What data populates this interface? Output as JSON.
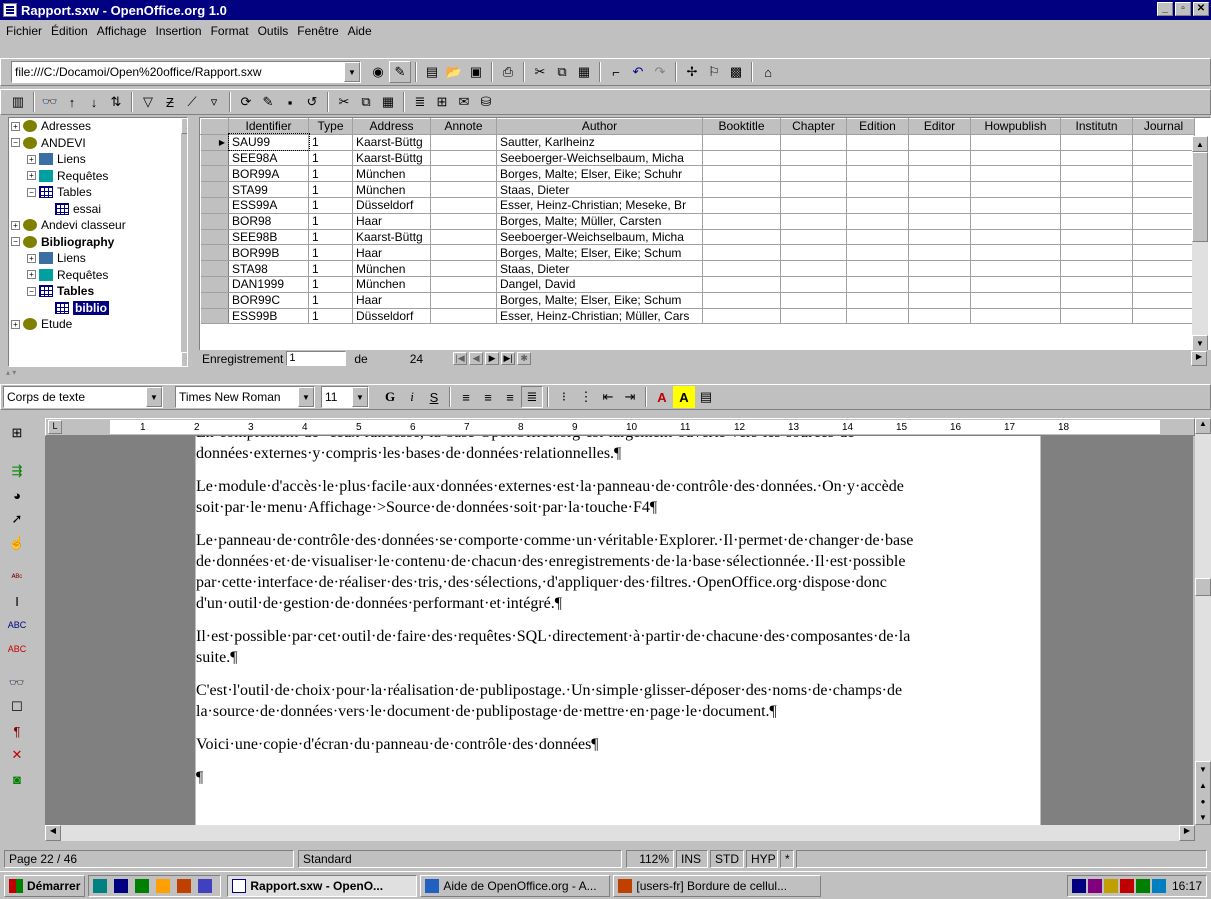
{
  "window": {
    "title": "Rapport.sxw - OpenOffice.org 1.0"
  },
  "menu": [
    "Fichier",
    "Édition",
    "Affichage",
    "Insertion",
    "Format",
    "Outils",
    "Fenêtre",
    "Aide"
  ],
  "url_bar": {
    "value": "file:///C:/Docamoi/Open%20office/Rapport.sxw"
  },
  "tree": [
    {
      "label": "Adresses",
      "level": 0,
      "expander": "+",
      "icon": "database-icon",
      "bold": false
    },
    {
      "label": "ANDEVI",
      "level": 0,
      "expander": "-",
      "icon": "database-icon",
      "bold": false
    },
    {
      "label": "Liens",
      "level": 1,
      "expander": "+",
      "icon": "links-icon",
      "bold": false
    },
    {
      "label": "Requêtes",
      "level": 1,
      "expander": "+",
      "icon": "queries-icon",
      "bold": false
    },
    {
      "label": "Tables",
      "level": 1,
      "expander": "-",
      "icon": "tables-icon",
      "bold": false
    },
    {
      "label": "essai",
      "level": 2,
      "expander": "",
      "icon": "table-icon",
      "bold": false
    },
    {
      "label": "Andevi classeur",
      "level": 0,
      "expander": "+",
      "icon": "database-icon",
      "bold": false
    },
    {
      "label": "Bibliography",
      "level": 0,
      "expander": "-",
      "icon": "database-icon",
      "bold": true
    },
    {
      "label": "Liens",
      "level": 1,
      "expander": "+",
      "icon": "links-icon",
      "bold": false
    },
    {
      "label": "Requêtes",
      "level": 1,
      "expander": "+",
      "icon": "queries-icon",
      "bold": false
    },
    {
      "label": "Tables",
      "level": 1,
      "expander": "-",
      "icon": "tables-icon",
      "bold": true
    },
    {
      "label": "biblio",
      "level": 2,
      "expander": "",
      "icon": "table-icon",
      "bold": true,
      "selected": true
    },
    {
      "label": "Etude",
      "level": 0,
      "expander": "+",
      "icon": "database-icon",
      "bold": false
    }
  ],
  "grid": {
    "columns": [
      "Identifier",
      "Type",
      "Address",
      "Annote",
      "Author",
      "Booktitle",
      "Chapter",
      "Edition",
      "Editor",
      "Howpublish",
      "Institutn",
      "Journal"
    ],
    "rows": [
      [
        "SAU99",
        "1",
        "Kaarst-Büttg",
        "",
        "Sautter, Karlheinz"
      ],
      [
        "SEE98A",
        "1",
        "Kaarst-Büttg",
        "",
        "Seeboerger-Weichselbaum, Micha"
      ],
      [
        "BOR99A",
        "1",
        "München",
        "",
        "Borges, Malte; Elser, Eike; Schuhr"
      ],
      [
        "STA99",
        "1",
        "München",
        "",
        "Staas, Dieter"
      ],
      [
        "ESS99A",
        "1",
        "Düsseldorf",
        "",
        "Esser, Heinz-Christian; Meseke, Br"
      ],
      [
        "BOR98",
        "1",
        "Haar",
        "",
        "Borges, Malte; Müller, Carsten"
      ],
      [
        "SEE98B",
        "1",
        "Kaarst-Büttg",
        "",
        "Seeboerger-Weichselbaum, Micha"
      ],
      [
        "BOR99B",
        "1",
        "Haar",
        "",
        "Borges, Malte; Elser, Eike; Schum"
      ],
      [
        "STA98",
        "1",
        "München",
        "",
        "Staas, Dieter"
      ],
      [
        "DAN1999",
        "1",
        "München",
        "",
        "Dangel, David"
      ],
      [
        "BOR99C",
        "1",
        "Haar",
        "",
        "Borges, Malte; Elser, Eike; Schum"
      ],
      [
        "ESS99B",
        "1",
        "Düsseldorf",
        "",
        "Esser, Heinz-Christian; Müller, Cars"
      ]
    ]
  },
  "record_nav": {
    "label": "Enregistrement",
    "current": "1",
    "of": "de",
    "total": "24"
  },
  "format": {
    "style": "Corps de texte",
    "font": "Times New Roman",
    "size": "11"
  },
  "doc": {
    "paragraphs": [
      "En·complément·de··ceux·ralicesse,·la·base·OpenOffice.org·est·largement·ouverte·vers·les·sources·de",
      "données·externes·y·compris·les·bases·de·données·relationnelles.¶",
      "Le·module·d'accès·le·plus·facile·aux·données·externes·est·la·panneau·de·contrôle·des·données.·On·y·accède",
      "soit·par·le·menu·Affichage·>Source·de·données·soit·par·la·touche·F4¶",
      "Le·panneau·de·contrôle·des·données·se·comporte·comme·un·véritable·Explorer.·Il·permet·de·changer·de·base",
      "de·données·et·de·visualiser·le·contenu·de·chacun·des·enregistrements·de·la·base·sélectionnée.·Il·est·possible",
      "par·cette·interface·de·réaliser·des·tris,·des·sélections,·d'appliquer·des·filtres.·OpenOffice.org·dispose·donc",
      "d'un·outil·de·gestion·de·données·performant·et·intégré.¶",
      "Il·est·possible·par·cet·outil·de·faire·des·requêtes·SQL·directement·à·partir·de·chacune·des·composantes·de·la",
      "suite.¶",
      "C'est·l'outil·de·choix·pour·la·réalisation·de·publipostage.·Un·simple·glisser-déposer·des·noms·de·champs·de",
      "la·source·de·données·vers·le·document·de·publipostage·de·mettre·en·page·le·document.¶",
      "Voici·une·copie·d'écran·du·panneau·de·contrôle·des·données¶",
      "¶"
    ]
  },
  "ruler_ticks": [
    "1",
    "2",
    "3",
    "4",
    "5",
    "6",
    "7",
    "8",
    "9",
    "10",
    "11",
    "12",
    "13",
    "14",
    "15",
    "16",
    "17",
    "18"
  ],
  "status": {
    "page": "Page 22 / 46",
    "style": "Standard",
    "zoom": "112%",
    "ins": "INS",
    "std": "STD",
    "hyp": "HYP",
    "mod": "*"
  },
  "taskbar": {
    "start": "Démarrer",
    "tasks": [
      "Rapport.sxw - OpenO...",
      "Aide de OpenOffice.org - A...",
      "[users-fr] Bordure de cellul..."
    ],
    "clock": "16:17"
  },
  "colors": {
    "titlebar": "#000080",
    "face": "#c0c0c0",
    "selection": "#000080"
  }
}
